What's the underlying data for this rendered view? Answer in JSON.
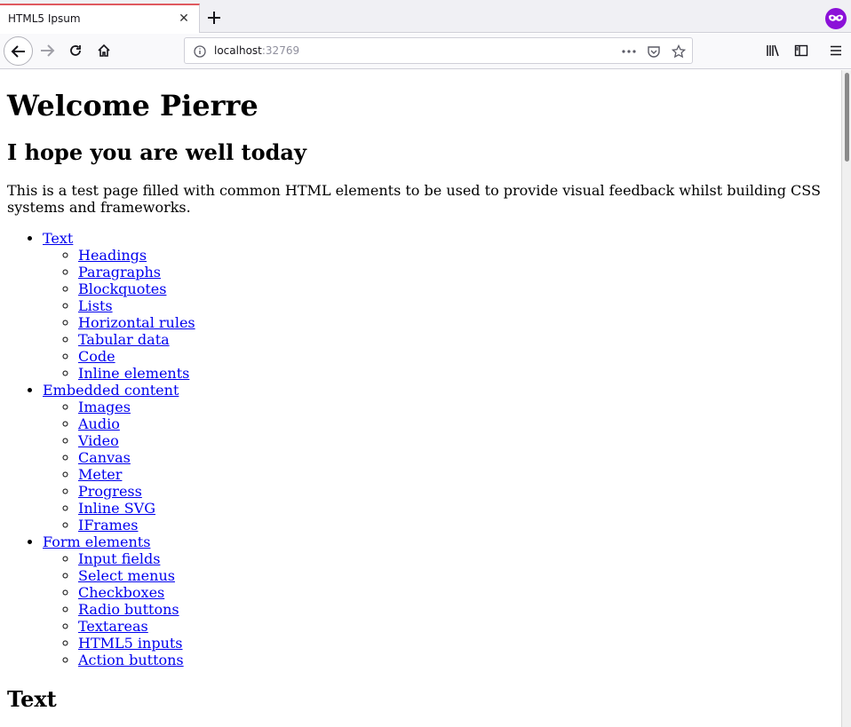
{
  "browser": {
    "tab_title": "HTML5 Ipsum",
    "url_host": "localhost",
    "url_port": ":32769",
    "accent": "#e0595f",
    "private_badge_color": "#8b10d8"
  },
  "page": {
    "heading": "Welcome Pierre",
    "subheading": "I hope you are well today",
    "intro": "This is a test page filled with common HTML elements to be used to provide visual feedback whilst building CSS systems and frameworks.",
    "toc": [
      {
        "label": "Text",
        "children": [
          "Headings",
          "Paragraphs",
          "Blockquotes",
          "Lists",
          "Horizontal rules",
          "Tabular data",
          "Code",
          "Inline elements"
        ]
      },
      {
        "label": "Embedded content",
        "children": [
          "Images",
          "Audio",
          "Video",
          "Canvas",
          "Meter",
          "Progress",
          "Inline SVG",
          "IFrames"
        ]
      },
      {
        "label": "Form elements",
        "children": [
          "Input fields",
          "Select menus",
          "Checkboxes",
          "Radio buttons",
          "Textareas",
          "HTML5 inputs",
          "Action buttons"
        ]
      }
    ],
    "section_heading": "Text"
  }
}
